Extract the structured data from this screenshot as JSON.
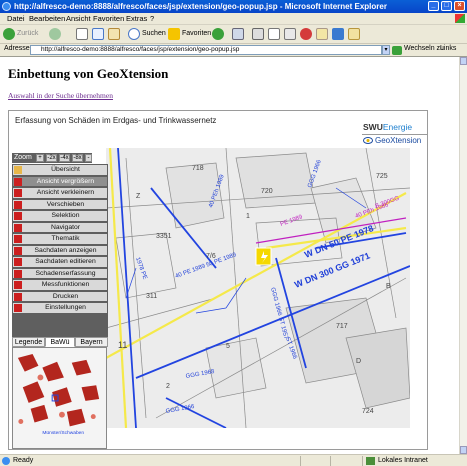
{
  "window": {
    "title": "http://alfresco-demo:8888/alfresco/faces/jsp/extension/geo-popup.jsp - Microsoft Internet Explorer",
    "minimize": "_",
    "maximize": "□",
    "close": "×"
  },
  "menubar": [
    "Datei",
    "Bearbeiten",
    "Ansicht",
    "Favoriten",
    "Extras",
    "?"
  ],
  "toolbar": {
    "back_label": "Zurück",
    "search_label": "Suchen",
    "favorites_label": "Favoriten"
  },
  "address": {
    "label": "Adresse",
    "url": "http://alfresco-demo:8888/alfresco/faces/jsp/extension/geo-popup.jsp",
    "go_label": "Wechseln zu",
    "links_label": "Links"
  },
  "page": {
    "heading": "Einbettung von GeoXtension",
    "link": "Auswahl in der Suche übernehmen"
  },
  "frame": {
    "title": "Erfassung von Schäden im Erdgas- und Trinkwassernetz",
    "logo": {
      "brand": "SWU",
      "brand_suffix": "Energie",
      "product": "GeoXtension"
    }
  },
  "zoom": {
    "label": "Zoom",
    "buttons": [
      "+",
      "-2x",
      "-4x",
      "-8x",
      "-"
    ]
  },
  "tools_menu": [
    {
      "label": "Übersicht",
      "active": false
    },
    {
      "label": "Ansicht vergrößern",
      "active": true
    },
    {
      "label": "Ansicht verkleinern",
      "active": false
    },
    {
      "label": "Verschieben",
      "active": false
    },
    {
      "label": "Selektion",
      "active": false
    },
    {
      "label": "Navigator",
      "active": false
    },
    {
      "label": "Thematik",
      "active": false
    },
    {
      "label": "Sachdaten anzeigen",
      "active": false
    },
    {
      "label": "Sachdaten editieren",
      "active": false
    },
    {
      "label": "Schadenserfassung",
      "active": false
    },
    {
      "label": "Messfunktionen",
      "active": false
    },
    {
      "label": "Drucken",
      "active": false
    },
    {
      "label": "Einstellungen",
      "active": false
    }
  ],
  "panel_tabs": [
    {
      "label": "Legende",
      "active": false
    },
    {
      "label": "BaWü",
      "active": true
    },
    {
      "label": "Bayern",
      "active": false
    }
  ],
  "map": {
    "labels": [
      "40 PEh 1989",
      "GGG 1966",
      "W DN 50 PE 1978",
      "W DN 300 GG 1971",
      "40 PEh 1986",
      "B 300GG",
      "PE 1989",
      "1978 PE",
      "GGG 1966 ST 1957",
      "40 PE 1989 50 PE 1989",
      "725",
      "724",
      "720",
      "718",
      "717",
      "11",
      "311",
      "3351",
      "2",
      "1",
      "5",
      "7/6",
      "ST 1966",
      "GGG 1968",
      "GGG 1966",
      "Z",
      "B",
      "D"
    ]
  },
  "overview": {
    "marker_label": "Münster/Schwaben"
  },
  "status": {
    "text": "Ready",
    "zone": "Lokales Intranet"
  },
  "colors": {
    "title_bar": "#0845c8",
    "menu_active": "#8f8f8f",
    "pipe_water": "#2244e0",
    "pipe_gas": "#f5e94a",
    "label_magenta": "#c020c0",
    "damage_marker": "#f5d800"
  }
}
